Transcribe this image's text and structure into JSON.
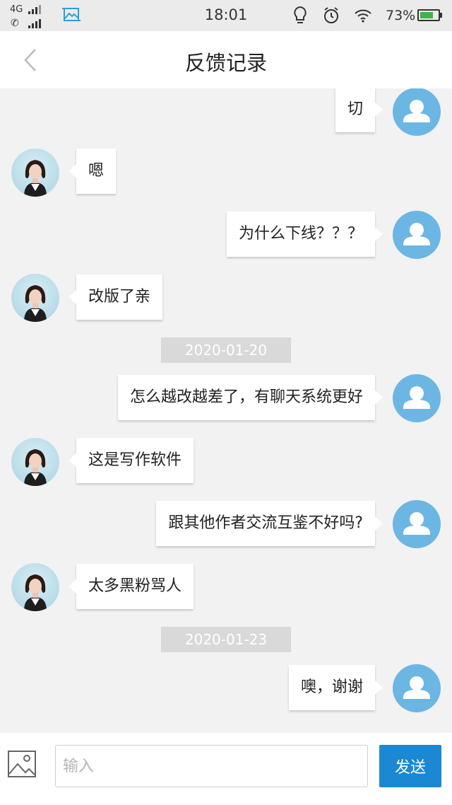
{
  "status_bar": {
    "network": "4G",
    "time": "18:01",
    "battery_percent": "73%",
    "battery_level": 0.73,
    "battery_color": "#3bb54a"
  },
  "header": {
    "title": "反馈记录",
    "back_icon": "chevron-left-icon"
  },
  "messages": [
    {
      "from": "user",
      "text": "切"
    },
    {
      "from": "agent",
      "text": "嗯"
    },
    {
      "from": "user",
      "text": "为什么下线？？？"
    },
    {
      "from": "agent",
      "text": "改版了亲"
    },
    {
      "date": "2020-01-20"
    },
    {
      "from": "user",
      "text": "怎么越改越差了，有聊天系统更好"
    },
    {
      "from": "agent",
      "text": "这是写作软件"
    },
    {
      "from": "user",
      "text": "跟其他作者交流互鉴不好吗?"
    },
    {
      "from": "agent",
      "text": "太多黑粉骂人"
    },
    {
      "date": "2020-01-23"
    },
    {
      "from": "user",
      "text": "噢，谢谢"
    }
  ],
  "input_bar": {
    "image_icon": "image-icon",
    "placeholder": "输入",
    "value": "",
    "send_label": "发送",
    "send_color": "#1a88d2"
  },
  "colors": {
    "user_avatar": "#6cb6e4",
    "background": "#f2f2f2",
    "date_badge": "#d9d9d9"
  }
}
